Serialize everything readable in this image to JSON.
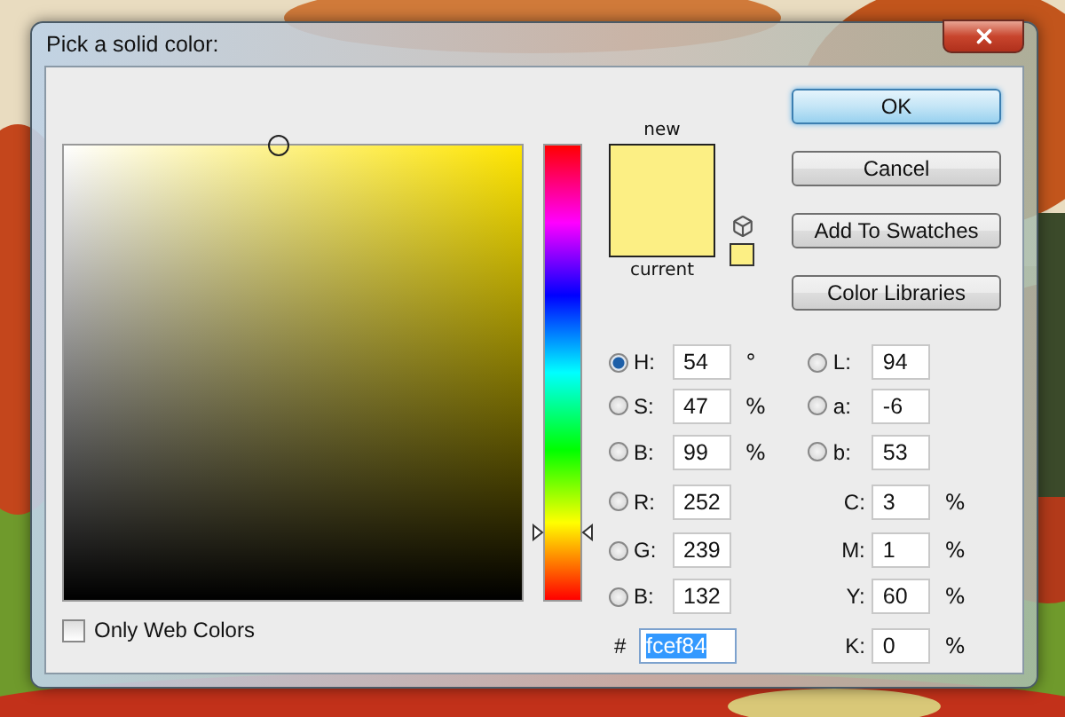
{
  "window": {
    "title": "Pick a solid color:"
  },
  "hue_slider": {
    "level": 0.15
  },
  "web_colors_checkbox": {
    "label": "Only Web Colors",
    "checked": false
  },
  "swatches": [
    {
      "label": "new",
      "color": "#fcef84"
    },
    {
      "label": "current",
      "color": "#fcef84"
    }
  ],
  "buttons": [
    {
      "label": "OK",
      "default": true
    },
    {
      "label": "Cancel",
      "default": false
    },
    {
      "label": "Add To Swatches",
      "default": false
    },
    {
      "label": "Color Libraries",
      "default": false
    }
  ],
  "fields_left": [
    {
      "kind": "radio",
      "label": "H:",
      "value": "54",
      "unit": "°",
      "selected": true
    },
    {
      "kind": "radio",
      "label": "S:",
      "value": "47",
      "unit": "%",
      "selected": false
    },
    {
      "kind": "radio",
      "label": "B:",
      "value": "99",
      "unit": "%",
      "selected": false
    },
    {
      "kind": "radio",
      "label": "R:",
      "value": "252",
      "selected": false
    },
    {
      "kind": "radio",
      "label": "G:",
      "value": "239",
      "selected": false
    },
    {
      "kind": "radio",
      "label": "B:",
      "value": "132",
      "selected": false
    },
    {
      "kind": "hex",
      "label": "#",
      "value": "fcef84",
      "highlighted": true
    }
  ],
  "fields_right": [
    {
      "kind": "radio",
      "label": "L:",
      "value": "94",
      "selected": false
    },
    {
      "kind": "radio",
      "label": "a:",
      "value": "-6",
      "selected": false
    },
    {
      "kind": "radio",
      "label": "b:",
      "value": "53",
      "selected": false
    },
    {
      "kind": "plain",
      "label": "C:",
      "value": "3",
      "unit": "%"
    },
    {
      "kind": "plain",
      "label": "M:",
      "value": "1",
      "unit": "%"
    },
    {
      "kind": "plain",
      "label": "Y:",
      "value": "60",
      "unit": "%"
    },
    {
      "kind": "plain",
      "label": "K:",
      "value": "0",
      "unit": "%"
    }
  ]
}
